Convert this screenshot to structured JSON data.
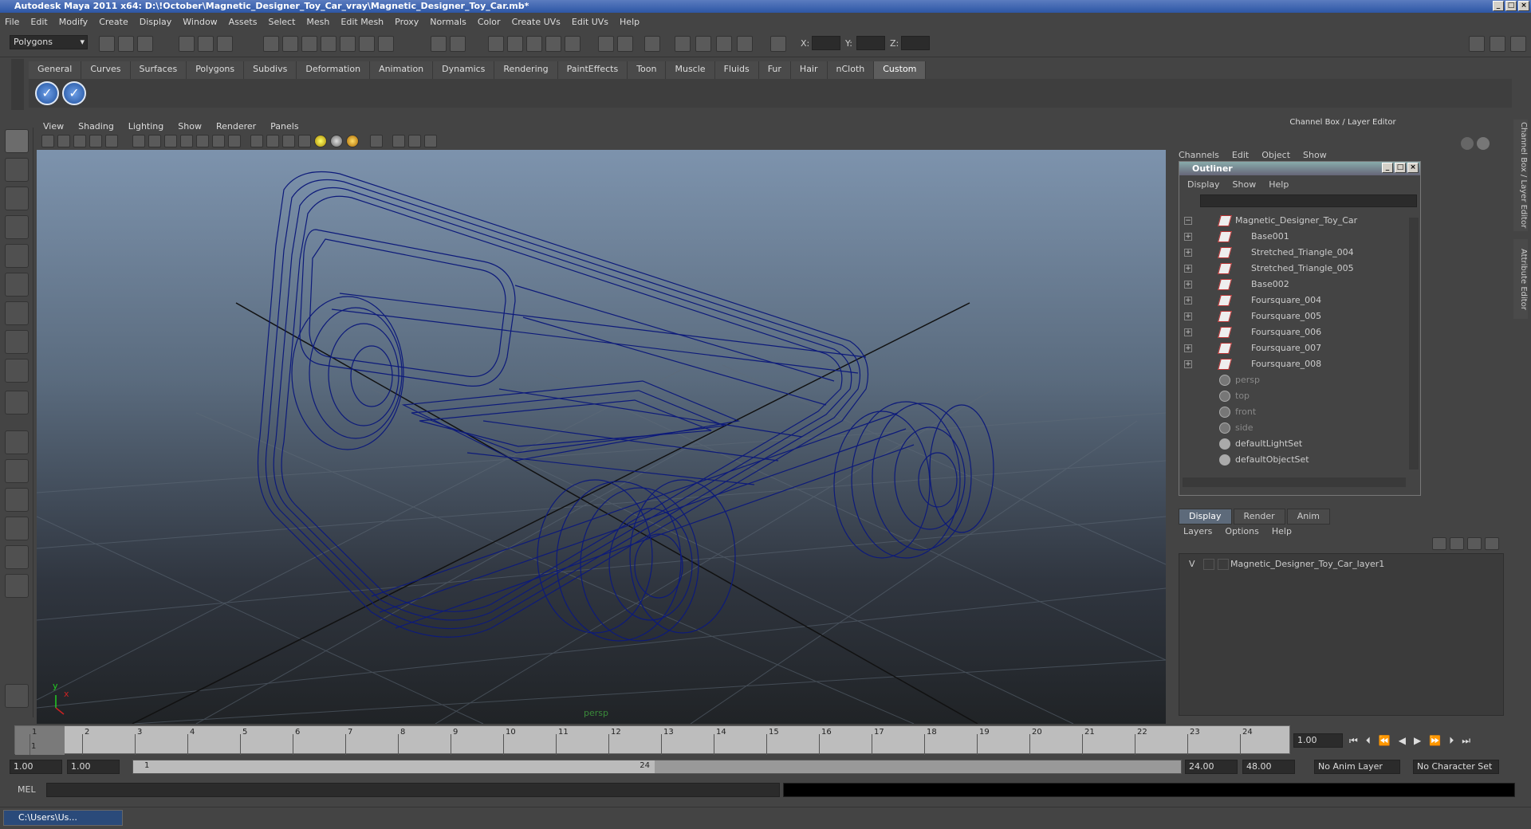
{
  "window": {
    "title": "Autodesk Maya 2011 x64: D:\\!October\\Magnetic_Designer_Toy_Car_vray\\Magnetic_Designer_Toy_Car.mb*"
  },
  "menu": [
    "File",
    "Edit",
    "Modify",
    "Create",
    "Display",
    "Window",
    "Assets",
    "Select",
    "Mesh",
    "Edit Mesh",
    "Proxy",
    "Normals",
    "Color",
    "Create UVs",
    "Edit UVs",
    "Help"
  ],
  "status": {
    "mode": "Polygons",
    "x_label": "X:",
    "y_label": "Y:",
    "z_label": "Z:"
  },
  "shelf": {
    "tabs": [
      "General",
      "Curves",
      "Surfaces",
      "Polygons",
      "Subdivs",
      "Deformation",
      "Animation",
      "Dynamics",
      "Rendering",
      "PaintEffects",
      "Toon",
      "Muscle",
      "Fluids",
      "Fur",
      "Hair",
      "nCloth",
      "Custom"
    ],
    "active": "Custom"
  },
  "viewport": {
    "menu": [
      "View",
      "Shading",
      "Lighting",
      "Show",
      "Renderer",
      "Panels"
    ],
    "camera_label": "persp",
    "axis_y": "y",
    "axis_x": "x",
    "wire_color": "#0d1a7a"
  },
  "channelbox": {
    "title": "Channel Box / Layer Editor",
    "menu": [
      "Channels",
      "Edit",
      "Object",
      "Show"
    ],
    "side_tab_1": "Channel Box / Layer Editor",
    "side_tab_2": "Attribute Editor"
  },
  "outliner": {
    "title": "Outliner",
    "menu": [
      "Display",
      "Show",
      "Help"
    ],
    "items": [
      {
        "label": "Magnetic_Designer_Toy_Car",
        "expander": "−",
        "kind": "mesh"
      },
      {
        "label": "Base001",
        "expander": "+",
        "kind": "mesh"
      },
      {
        "label": "Stretched_Triangle_004",
        "expander": "+",
        "kind": "mesh"
      },
      {
        "label": "Stretched_Triangle_005",
        "expander": "+",
        "kind": "mesh"
      },
      {
        "label": "Base002",
        "expander": "+",
        "kind": "mesh"
      },
      {
        "label": "Foursquare_004",
        "expander": "+",
        "kind": "mesh"
      },
      {
        "label": "Foursquare_005",
        "expander": "+",
        "kind": "mesh"
      },
      {
        "label": "Foursquare_006",
        "expander": "+",
        "kind": "mesh"
      },
      {
        "label": "Foursquare_007",
        "expander": "+",
        "kind": "mesh"
      },
      {
        "label": "Foursquare_008",
        "expander": "+",
        "kind": "mesh"
      },
      {
        "label": "persp",
        "expander": "",
        "kind": "camera"
      },
      {
        "label": "top",
        "expander": "",
        "kind": "camera"
      },
      {
        "label": "front",
        "expander": "",
        "kind": "camera"
      },
      {
        "label": "side",
        "expander": "",
        "kind": "camera"
      },
      {
        "label": "defaultLightSet",
        "expander": "",
        "kind": "set"
      },
      {
        "label": "defaultObjectSet",
        "expander": "",
        "kind": "set"
      }
    ]
  },
  "layers": {
    "tabs": [
      "Display",
      "Render",
      "Anim"
    ],
    "menu": [
      "Layers",
      "Options",
      "Help"
    ],
    "row": {
      "visible": "V",
      "name": "Magnetic_Designer_Toy_Car_layer1"
    }
  },
  "timeline": {
    "ticks": [
      "1",
      "2",
      "3",
      "4",
      "5",
      "6",
      "7",
      "8",
      "9",
      "10",
      "11",
      "12",
      "13",
      "14",
      "15",
      "16",
      "17",
      "18",
      "19",
      "20",
      "21",
      "22",
      "23",
      "24"
    ],
    "current_frame_label": "1",
    "current_time": "1.00"
  },
  "range": {
    "start": "1.00",
    "start2": "1.00",
    "slider_start": "1",
    "slider_end": "24",
    "end": "24.00",
    "end2": "48.00",
    "anim_layer": "No Anim Layer",
    "char_set": "No Character Set"
  },
  "cmd": {
    "label": "MEL"
  },
  "taskbar": {
    "item": "C:\\Users\\Us..."
  }
}
